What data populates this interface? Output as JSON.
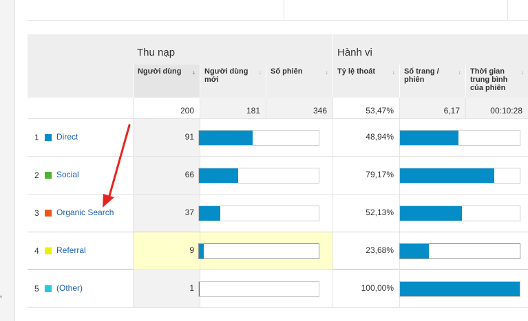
{
  "groups": {
    "acquisition": "Thu nạp",
    "behavior": "Hành vi"
  },
  "columns": [
    {
      "label": "Người dùng",
      "sorted": true
    },
    {
      "label": "Người dùng mới",
      "sorted": false
    },
    {
      "label": "Số phiên",
      "sorted": false
    },
    {
      "label": "Tỷ lệ thoát",
      "sorted": false
    },
    {
      "label": "Số trang / phiên",
      "sorted": false
    },
    {
      "label": "Thời gian trung bình của phiên",
      "sorted": false
    }
  ],
  "totals": [
    "200",
    "181",
    "346",
    "53,47%",
    "6,17",
    "00:10:28"
  ],
  "rows": [
    {
      "index": "1",
      "channel": "Direct",
      "color": "#058dc7",
      "users": "91",
      "new_users_fraction": 0.45,
      "bounce_rate": "48,94%",
      "pages_fraction": 0.49
    },
    {
      "index": "2",
      "channel": "Social",
      "color": "#50b432",
      "users": "66",
      "new_users_fraction": 0.33,
      "bounce_rate": "79,17%",
      "pages_fraction": 0.79
    },
    {
      "index": "3",
      "channel": "Organic Search",
      "color": "#ed561b",
      "users": "37",
      "new_users_fraction": 0.18,
      "bounce_rate": "52,13%",
      "pages_fraction": 0.52
    },
    {
      "index": "4",
      "channel": "Referral",
      "color": "#edef00",
      "users": "9",
      "new_users_fraction": 0.04,
      "bounce_rate": "23,68%",
      "pages_fraction": 0.24
    },
    {
      "index": "5",
      "channel": "(Other)",
      "color": "#24cbe5",
      "users": "1",
      "new_users_fraction": 0.006,
      "bounce_rate": "100,00%",
      "pages_fraction": 1.0
    }
  ],
  "sort_icon": "arrow-down-icon",
  "annotation": {
    "type": "red-arrow",
    "color": "#e8231f"
  }
}
